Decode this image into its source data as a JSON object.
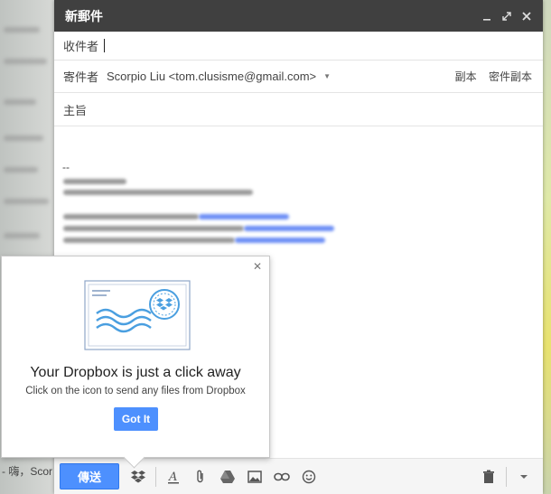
{
  "background": {
    "snippet": "- 嗨，Scor"
  },
  "compose": {
    "title": "新郵件",
    "to_label": "收件者",
    "from_label": "寄件者",
    "from_value": "Scorpio Liu <tom.clusisme@gmail.com>",
    "cc_label": "副本",
    "bcc_label": "密件副本",
    "subject_placeholder": "主旨",
    "signature_dash": "--",
    "send_label": "傳送"
  },
  "popup": {
    "headline": "Your Dropbox is just a click away",
    "subtext": "Click on the icon to send any files from Dropbox",
    "button_label": "Got It"
  },
  "colors": {
    "accent": "#4d90fe",
    "titlebar": "#404040",
    "link": "#6c8ef5"
  },
  "toolbar_icons": [
    "dropbox-icon",
    "formatting-icon",
    "attach-icon",
    "drive-icon",
    "photo-icon",
    "link-icon",
    "emoji-icon",
    "trash-icon",
    "more-options-icon"
  ]
}
